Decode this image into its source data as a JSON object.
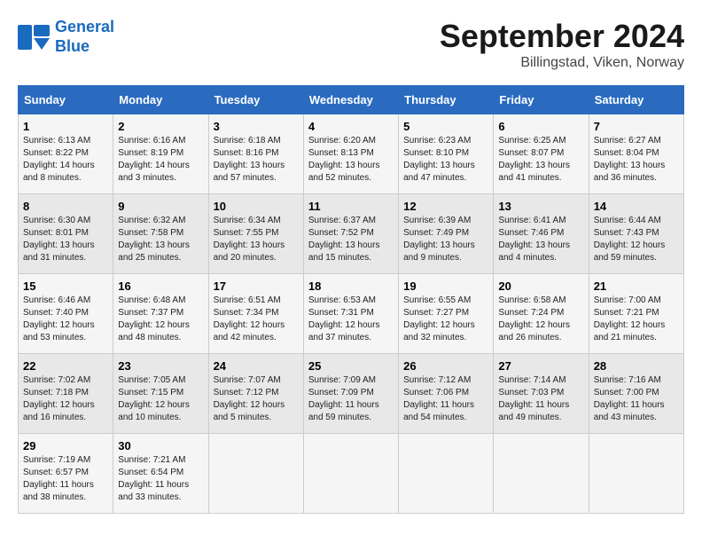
{
  "header": {
    "logo_line1": "General",
    "logo_line2": "Blue",
    "month": "September 2024",
    "location": "Billingstad, Viken, Norway"
  },
  "weekdays": [
    "Sunday",
    "Monday",
    "Tuesday",
    "Wednesday",
    "Thursday",
    "Friday",
    "Saturday"
  ],
  "weeks": [
    [
      {
        "day": "1",
        "sunrise": "6:13 AM",
        "sunset": "8:22 PM",
        "daylight": "14 hours and 8 minutes."
      },
      {
        "day": "2",
        "sunrise": "6:16 AM",
        "sunset": "8:19 PM",
        "daylight": "14 hours and 3 minutes."
      },
      {
        "day": "3",
        "sunrise": "6:18 AM",
        "sunset": "8:16 PM",
        "daylight": "13 hours and 57 minutes."
      },
      {
        "day": "4",
        "sunrise": "6:20 AM",
        "sunset": "8:13 PM",
        "daylight": "13 hours and 52 minutes."
      },
      {
        "day": "5",
        "sunrise": "6:23 AM",
        "sunset": "8:10 PM",
        "daylight": "13 hours and 47 minutes."
      },
      {
        "day": "6",
        "sunrise": "6:25 AM",
        "sunset": "8:07 PM",
        "daylight": "13 hours and 41 minutes."
      },
      {
        "day": "7",
        "sunrise": "6:27 AM",
        "sunset": "8:04 PM",
        "daylight": "13 hours and 36 minutes."
      }
    ],
    [
      {
        "day": "8",
        "sunrise": "6:30 AM",
        "sunset": "8:01 PM",
        "daylight": "13 hours and 31 minutes."
      },
      {
        "day": "9",
        "sunrise": "6:32 AM",
        "sunset": "7:58 PM",
        "daylight": "13 hours and 25 minutes."
      },
      {
        "day": "10",
        "sunrise": "6:34 AM",
        "sunset": "7:55 PM",
        "daylight": "13 hours and 20 minutes."
      },
      {
        "day": "11",
        "sunrise": "6:37 AM",
        "sunset": "7:52 PM",
        "daylight": "13 hours and 15 minutes."
      },
      {
        "day": "12",
        "sunrise": "6:39 AM",
        "sunset": "7:49 PM",
        "daylight": "13 hours and 9 minutes."
      },
      {
        "day": "13",
        "sunrise": "6:41 AM",
        "sunset": "7:46 PM",
        "daylight": "13 hours and 4 minutes."
      },
      {
        "day": "14",
        "sunrise": "6:44 AM",
        "sunset": "7:43 PM",
        "daylight": "12 hours and 59 minutes."
      }
    ],
    [
      {
        "day": "15",
        "sunrise": "6:46 AM",
        "sunset": "7:40 PM",
        "daylight": "12 hours and 53 minutes."
      },
      {
        "day": "16",
        "sunrise": "6:48 AM",
        "sunset": "7:37 PM",
        "daylight": "12 hours and 48 minutes."
      },
      {
        "day": "17",
        "sunrise": "6:51 AM",
        "sunset": "7:34 PM",
        "daylight": "12 hours and 42 minutes."
      },
      {
        "day": "18",
        "sunrise": "6:53 AM",
        "sunset": "7:31 PM",
        "daylight": "12 hours and 37 minutes."
      },
      {
        "day": "19",
        "sunrise": "6:55 AM",
        "sunset": "7:27 PM",
        "daylight": "12 hours and 32 minutes."
      },
      {
        "day": "20",
        "sunrise": "6:58 AM",
        "sunset": "7:24 PM",
        "daylight": "12 hours and 26 minutes."
      },
      {
        "day": "21",
        "sunrise": "7:00 AM",
        "sunset": "7:21 PM",
        "daylight": "12 hours and 21 minutes."
      }
    ],
    [
      {
        "day": "22",
        "sunrise": "7:02 AM",
        "sunset": "7:18 PM",
        "daylight": "12 hours and 16 minutes."
      },
      {
        "day": "23",
        "sunrise": "7:05 AM",
        "sunset": "7:15 PM",
        "daylight": "12 hours and 10 minutes."
      },
      {
        "day": "24",
        "sunrise": "7:07 AM",
        "sunset": "7:12 PM",
        "daylight": "12 hours and 5 minutes."
      },
      {
        "day": "25",
        "sunrise": "7:09 AM",
        "sunset": "7:09 PM",
        "daylight": "11 hours and 59 minutes."
      },
      {
        "day": "26",
        "sunrise": "7:12 AM",
        "sunset": "7:06 PM",
        "daylight": "11 hours and 54 minutes."
      },
      {
        "day": "27",
        "sunrise": "7:14 AM",
        "sunset": "7:03 PM",
        "daylight": "11 hours and 49 minutes."
      },
      {
        "day": "28",
        "sunrise": "7:16 AM",
        "sunset": "7:00 PM",
        "daylight": "11 hours and 43 minutes."
      }
    ],
    [
      {
        "day": "29",
        "sunrise": "7:19 AM",
        "sunset": "6:57 PM",
        "daylight": "11 hours and 38 minutes."
      },
      {
        "day": "30",
        "sunrise": "7:21 AM",
        "sunset": "6:54 PM",
        "daylight": "11 hours and 33 minutes."
      },
      null,
      null,
      null,
      null,
      null
    ]
  ]
}
